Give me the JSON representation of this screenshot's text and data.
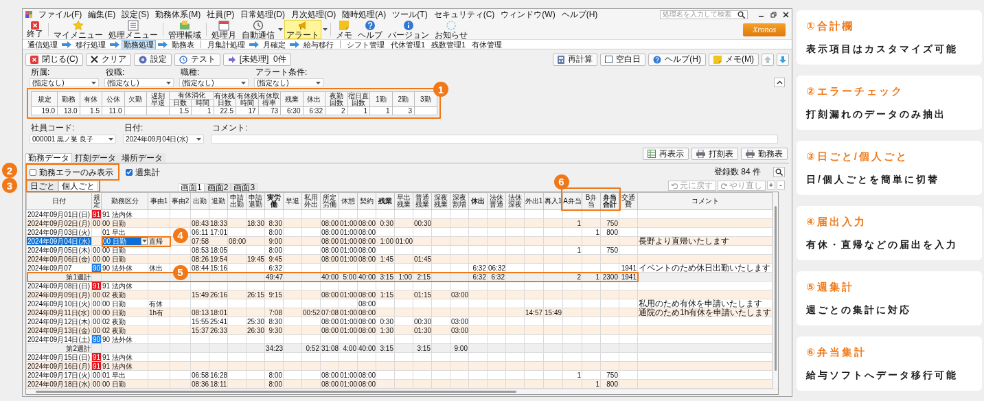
{
  "window": {
    "menu": [
      "ファイル(F)",
      "編集(E)",
      "設定(S)",
      "勤務体系(M)",
      "社員(P)",
      "日常処理(D)",
      "月次処理(O)",
      "随時処理(A)",
      "ツール(T)",
      "セキュリティ(C)",
      "ウィンドウ(W)",
      "ヘルプ(H)"
    ],
    "search": {
      "placeholder": "処理名を入力して検索"
    }
  },
  "toolbar": [
    {
      "label": "終了",
      "dropdown": false,
      "highlighted": false
    },
    {
      "label": "マイメニュー",
      "dropdown": false,
      "highlighted": false
    },
    {
      "label": "処理メニュー",
      "dropdown": false,
      "highlighted": false
    },
    {
      "label": "管理帳域",
      "dropdown": false,
      "highlighted": false
    },
    {
      "label": "処理月",
      "dropdown": false,
      "highlighted": false
    },
    {
      "label": "自動通信",
      "dropdown": true,
      "highlighted": false
    },
    {
      "label": "アラート",
      "dropdown": true,
      "highlighted": true
    },
    {
      "label": "メモ",
      "dropdown": false,
      "highlighted": false
    },
    {
      "label": "ヘルプ",
      "dropdown": false,
      "highlighted": false
    },
    {
      "label": "バージョン",
      "dropdown": false,
      "highlighted": false
    },
    {
      "label": "お知らせ",
      "dropdown": false,
      "highlighted": false
    }
  ],
  "logo": {
    "text": "Xronos"
  },
  "nav": [
    {
      "kind": "flow",
      "items": [
        {
          "label": "通信処理",
          "selected": false
        },
        {
          "label": "移行処理",
          "selected": false
        },
        {
          "label": "勤務処理",
          "selected": true
        },
        {
          "label": "勤務表",
          "selected": false
        }
      ]
    },
    {
      "kind": "flow",
      "items": [
        {
          "label": "月集計処理",
          "selected": false
        },
        {
          "label": "月確定",
          "selected": false
        },
        {
          "label": "給与移行",
          "selected": false
        }
      ]
    },
    {
      "kind": "links",
      "items": [
        {
          "label": "シフト管理",
          "selected": false
        },
        {
          "label": "代休管理1",
          "selected": false
        },
        {
          "label": "残数管理1",
          "selected": false
        },
        {
          "label": "有休管理",
          "selected": false
        }
      ]
    }
  ],
  "actions": {
    "left": [
      {
        "label": "閉じる(C)"
      },
      {
        "label": "クリア"
      },
      {
        "label": "設定"
      },
      {
        "label": "テスト"
      },
      {
        "label": "[未処理]  0件"
      }
    ],
    "right": [
      {
        "label": "再計算"
      },
      {
        "label": "空白日"
      },
      {
        "label": "ヘルプ(H)"
      },
      {
        "label": "メモ(M)"
      }
    ]
  },
  "filters": [
    {
      "label": "所属:",
      "value": "(指定なし)"
    },
    {
      "label": "役職:",
      "value": "(指定なし)"
    },
    {
      "label": "職種:",
      "value": "(指定なし)"
    },
    {
      "label": "アラート条件:",
      "value": "(指定なし)"
    }
  ],
  "summary": {
    "headers": [
      {
        "label": "規定",
        "value": "19.0"
      },
      {
        "label": "勤務",
        "value": "13.0"
      },
      {
        "label": "有休",
        "value": "1.5"
      },
      {
        "label": "公休",
        "value": "11.0"
      },
      {
        "label": "欠勤"
      },
      {
        "label": "遅刻早退"
      },
      {
        "label": "有休消化",
        "sub": [
          {
            "label": "日数",
            "value": "1.5"
          },
          {
            "label": "時間",
            "value": "1"
          }
        ]
      },
      {
        "label": "有休残日数",
        "value": "22.5"
      },
      {
        "label": "有休残時間",
        "value": "17"
      },
      {
        "label": "有休取得率",
        "value": "73"
      },
      {
        "label": "残業",
        "value": "6:30"
      },
      {
        "label": "休出",
        "value": "6:32"
      },
      {
        "label": "夜勤回数",
        "value": "2"
      },
      {
        "label": "宿日直回数",
        "value": "1"
      },
      {
        "label": "1勤",
        "value": "1"
      },
      {
        "label": "2勤",
        "value": "3"
      },
      {
        "label": "3勤"
      }
    ]
  },
  "employee": [
    {
      "label": "社員コード:",
      "kind": "select",
      "value": "000001 黒ノ巣 良子"
    },
    {
      "label": "日付:",
      "kind": "select",
      "value": "2024年09月04日(水)"
    },
    {
      "label": "コメント:",
      "kind": "text"
    }
  ],
  "reports": [
    {
      "label": "再表示"
    },
    {
      "label": "打刻表"
    },
    {
      "label": "勤務表"
    }
  ],
  "tabs": [
    {
      "label": "勤務データ",
      "selected": true
    },
    {
      "label": "打刻データ",
      "selected": false
    },
    {
      "label": "場所データ",
      "selected": false
    }
  ],
  "options": [
    {
      "label": "勤務エラーのみ表示",
      "checked": false
    },
    {
      "label": "週集計",
      "checked": true
    }
  ],
  "count": "登録数 84 件",
  "view_toggle": [
    {
      "label": "日ごと",
      "selected": false
    },
    {
      "label": "個人ごと",
      "selected": true
    }
  ],
  "screens": [
    {
      "label": "画面1",
      "selected": true
    },
    {
      "label": "画面2",
      "selected": false
    },
    {
      "label": "画面3",
      "selected": false
    }
  ],
  "history": [
    {
      "label": "元に戻す",
      "disabled": true
    },
    {
      "label": "やり直し",
      "disabled": true
    }
  ],
  "zoom_buttons": [
    "+",
    "-"
  ],
  "grid": {
    "columns": [
      {
        "label": "日付",
        "bold": false
      },
      {
        "label": "規定",
        "bold": false
      },
      {
        "label": "勤務区分",
        "bold": false
      },
      {
        "label": "事由1",
        "bold": false
      },
      {
        "label": "事由2",
        "bold": false
      },
      {
        "label": "出勤",
        "bold": false
      },
      {
        "label": "退勤",
        "bold": false
      },
      {
        "label": "申請出勤",
        "bold": false
      },
      {
        "label": "申請退勤",
        "bold": false
      },
      {
        "label": "実労働",
        "bold": true
      },
      {
        "label": "早退",
        "bold": false
      },
      {
        "label": "私用外出",
        "bold": false
      },
      {
        "label": "所定労働",
        "bold": false
      },
      {
        "label": "休憩",
        "bold": false
      },
      {
        "label": "契約",
        "bold": false
      },
      {
        "label": "残業",
        "bold": true
      },
      {
        "label": "早出残業",
        "bold": false
      },
      {
        "label": "普通残業",
        "bold": false
      },
      {
        "label": "深夜残業",
        "bold": false
      },
      {
        "label": "深夜割増",
        "bold": false
      },
      {
        "label": "休出",
        "bold": true
      },
      {
        "label": "法休普通",
        "bold": false
      },
      {
        "label": "法休深夜",
        "bold": false
      },
      {
        "label": "外出1",
        "bold": false
      },
      {
        "label": "再入1",
        "bold": false
      },
      {
        "label": "A弁当",
        "bold": false
      },
      {
        "label": "B弁当",
        "bold": false
      },
      {
        "label": "弁当合計",
        "bold": true
      },
      {
        "label": "交通費",
        "bold": false
      },
      {
        "label": "コメント",
        "bold": false
      }
    ],
    "rows": [
      {
        "kind": "day",
        "selected": false,
        "color": "#e8141c",
        "cells": [
          "2024年09月01日(日)",
          "91",
          "91 法内休",
          null,
          null,
          null,
          null,
          null,
          null,
          null,
          null,
          null,
          null,
          null,
          null,
          null,
          null,
          null,
          null,
          null,
          null,
          null,
          null,
          null,
          null,
          null,
          null,
          null,
          null,
          null
        ]
      },
      {
        "kind": "day",
        "selected": false,
        "cells": [
          "2024年09月02日(月)",
          "00",
          "00 日勤",
          null,
          null,
          "08:43",
          "18:33",
          null,
          "18:30",
          "8:30",
          null,
          null,
          "08:00",
          "01:00",
          "08:00",
          "0:30",
          null,
          "00:30",
          null,
          null,
          null,
          null,
          null,
          null,
          null,
          "1",
          null,
          "750",
          null,
          null
        ]
      },
      {
        "kind": "day",
        "selected": false,
        "cells": [
          "2024年09月03日(火)",
          null,
          "01 早出",
          null,
          null,
          "06:11",
          "17:01",
          null,
          null,
          "8:00",
          null,
          null,
          "08:00",
          "01:00",
          "08:00",
          null,
          null,
          null,
          null,
          null,
          null,
          null,
          null,
          null,
          null,
          null,
          "1",
          "800",
          null,
          null
        ]
      },
      {
        "kind": "day",
        "selected": true,
        "cells": [
          "2024年09月04日(水)",
          null,
          "00 日勤",
          "直帰",
          null,
          "07:58",
          null,
          "08:00",
          null,
          "9:00",
          null,
          null,
          "08:00",
          "01:00",
          "08:00",
          "1:00",
          "01:00",
          null,
          null,
          null,
          null,
          null,
          null,
          null,
          null,
          null,
          null,
          null,
          null,
          "長野より直帰いたします"
        ]
      },
      {
        "kind": "day",
        "selected": false,
        "cells": [
          "2024年09月05日(木)",
          "00",
          "00 日勤",
          null,
          null,
          "08:53",
          "18:05",
          null,
          null,
          "8:00",
          null,
          null,
          "08:00",
          "01:00",
          "08:00",
          null,
          null,
          null,
          null,
          null,
          null,
          null,
          null,
          null,
          null,
          "1",
          null,
          "750",
          null,
          null
        ]
      },
      {
        "kind": "day",
        "selected": false,
        "cells": [
          "2024年09月06日(金)",
          "00",
          "00 日勤",
          null,
          null,
          "08:26",
          "19:54",
          null,
          "19:45",
          "9:45",
          null,
          null,
          "08:00",
          "01:00",
          "08:00",
          "1:45",
          null,
          "01:45",
          null,
          null,
          null,
          null,
          null,
          null,
          null,
          null,
          null,
          null,
          null,
          null
        ]
      },
      {
        "kind": "day",
        "selected": false,
        "color": "#1e7ee8",
        "cells": [
          "2024年09月07",
          "90",
          "90 法外休",
          "休出",
          null,
          "08:44",
          "15:16",
          null,
          null,
          "6:32",
          null,
          null,
          null,
          null,
          null,
          null,
          null,
          null,
          null,
          null,
          "6:32",
          "06:32",
          null,
          null,
          null,
          null,
          null,
          null,
          "1941",
          "イベントのため休日出勤いたします"
        ]
      },
      {
        "kind": "total",
        "selected": false,
        "cells": [
          "第1週計",
          null,
          null,
          null,
          null,
          null,
          null,
          null,
          null,
          "49:47",
          null,
          null,
          "40:00",
          "5:00",
          "40:00",
          "3:15",
          "1:00",
          "2:15",
          null,
          null,
          "6:32",
          "6:32",
          null,
          null,
          null,
          "2",
          "1",
          "2300",
          "1941",
          null
        ]
      },
      {
        "kind": "day",
        "selected": false,
        "color": "#e8141c",
        "cells": [
          "2024年09月08日(日)",
          "91",
          "91 法内休",
          null,
          null,
          null,
          null,
          null,
          null,
          null,
          null,
          null,
          null,
          null,
          null,
          null,
          null,
          null,
          null,
          null,
          null,
          null,
          null,
          null,
          null,
          null,
          null,
          null,
          null,
          null
        ]
      },
      {
        "kind": "day",
        "selected": false,
        "cells": [
          "2024年09月09日(月)",
          "00",
          "02 夜勤",
          null,
          null,
          "15:49",
          "26:16",
          null,
          "26:15",
          "9:15",
          null,
          null,
          "08:00",
          "01:00",
          "08:00",
          "1:15",
          null,
          "01:15",
          null,
          "03:00",
          null,
          null,
          null,
          null,
          null,
          null,
          null,
          null,
          null,
          null
        ]
      },
      {
        "kind": "day",
        "selected": false,
        "cells": [
          "2024年09月10日(火)",
          "00",
          "00 日勤",
          "有休",
          null,
          null,
          null,
          null,
          null,
          null,
          null,
          null,
          null,
          null,
          "08:00",
          null,
          null,
          null,
          null,
          null,
          null,
          null,
          null,
          null,
          null,
          null,
          null,
          null,
          null,
          "私用のため有休を申請いたします"
        ]
      },
      {
        "kind": "day",
        "selected": false,
        "cells": [
          "2024年09月11日(水)",
          "00",
          "00 日勤",
          "1h有",
          null,
          "08:13",
          "18:01",
          null,
          null,
          "7:08",
          null,
          "00:52",
          "07:08",
          "01:00",
          "08:00",
          null,
          null,
          null,
          null,
          null,
          null,
          null,
          null,
          "14:57",
          "15:49",
          null,
          null,
          null,
          null,
          "通院のため1h有休を申請いたします"
        ]
      },
      {
        "kind": "day",
        "selected": false,
        "cells": [
          "2024年09月12日(木)",
          "00",
          "02 夜勤",
          null,
          null,
          "15:55",
          "25:41",
          null,
          "25:30",
          "8:30",
          null,
          null,
          "08:00",
          "01:00",
          "08:00",
          "0:30",
          null,
          "00:30",
          null,
          "03:00",
          null,
          null,
          null,
          null,
          null,
          null,
          null,
          null,
          null,
          null
        ]
      },
      {
        "kind": "day",
        "selected": false,
        "cells": [
          "2024年09月13日(金)",
          "00",
          "02 夜勤",
          null,
          null,
          "15:37",
          "26:33",
          null,
          "26:30",
          "9:30",
          null,
          null,
          "08:00",
          "01:00",
          "08:00",
          "1:30",
          null,
          "01:30",
          null,
          "03:00",
          null,
          null,
          null,
          null,
          null,
          null,
          null,
          null,
          null,
          null
        ]
      },
      {
        "kind": "day",
        "selected": false,
        "color": "#1e7ee8",
        "cells": [
          "2024年09月14日(土)",
          "90",
          "90 法外休",
          null,
          null,
          null,
          null,
          null,
          null,
          null,
          null,
          null,
          null,
          null,
          null,
          null,
          null,
          null,
          null,
          null,
          null,
          null,
          null,
          null,
          null,
          null,
          null,
          null,
          null,
          null
        ]
      },
      {
        "kind": "total",
        "selected": false,
        "cells": [
          "第2週計",
          null,
          null,
          null,
          null,
          null,
          null,
          null,
          null,
          "34:23",
          null,
          "0:52",
          "31:08",
          "4:00",
          "40:00",
          "3:15",
          null,
          "3:15",
          null,
          "9:00",
          null,
          null,
          null,
          null,
          null,
          null,
          null,
          null,
          null,
          null
        ]
      },
      {
        "kind": "day",
        "selected": false,
        "color": "#e8141c",
        "cells": [
          "2024年09月15日(日)",
          "91",
          "91 法内休",
          null,
          null,
          null,
          null,
          null,
          null,
          null,
          null,
          null,
          null,
          null,
          null,
          null,
          null,
          null,
          null,
          null,
          null,
          null,
          null,
          null,
          null,
          null,
          null,
          null,
          null,
          null
        ]
      },
      {
        "kind": "day",
        "selected": false,
        "color": "#e8141c",
        "cells": [
          "2024年09月16日(月)",
          "91",
          "91 法内休",
          null,
          null,
          null,
          null,
          null,
          null,
          null,
          null,
          null,
          null,
          null,
          null,
          null,
          null,
          null,
          null,
          null,
          null,
          null,
          null,
          null,
          null,
          null,
          null,
          null,
          null,
          null
        ]
      },
      {
        "kind": "day",
        "selected": false,
        "cells": [
          "2024年09月17日(火)",
          "00",
          "01 早出",
          null,
          null,
          "06:58",
          "16:28",
          null,
          null,
          "8:00",
          null,
          null,
          "08:00",
          "01:00",
          "08:00",
          null,
          null,
          null,
          null,
          null,
          null,
          null,
          null,
          null,
          null,
          "1",
          null,
          "750",
          null,
          null
        ]
      },
      {
        "kind": "day",
        "selected": false,
        "cells": [
          "2024年09月18日(水)",
          "00",
          "00 日勤",
          null,
          null,
          "08:36",
          "18:11",
          null,
          null,
          "8:00",
          null,
          null,
          "08:00",
          "01:00",
          "08:00",
          null,
          null,
          null,
          null,
          null,
          null,
          null,
          null,
          null,
          null,
          null,
          "1",
          "800",
          null,
          null
        ]
      }
    ]
  },
  "callouts": [
    "1",
    "2",
    "3",
    "4",
    "5",
    "6"
  ],
  "features": [
    {
      "title": "①合計欄",
      "text": "表示項目はカスタマイズ可能"
    },
    {
      "title": "②エラーチェック",
      "text": "打刻漏れのデータのみ抽出"
    },
    {
      "title": "③日ごと/個人ごと",
      "text": "日/個人ごとを簡単に切替"
    },
    {
      "title": "④届出入力",
      "text": "有休・直帰などの届出を入力"
    },
    {
      "title": "⑤週集計",
      "text": "週ごとの集計に対応"
    },
    {
      "title": "⑥弁当集計",
      "text": "給与ソフトへデータ移行可能"
    }
  ]
}
